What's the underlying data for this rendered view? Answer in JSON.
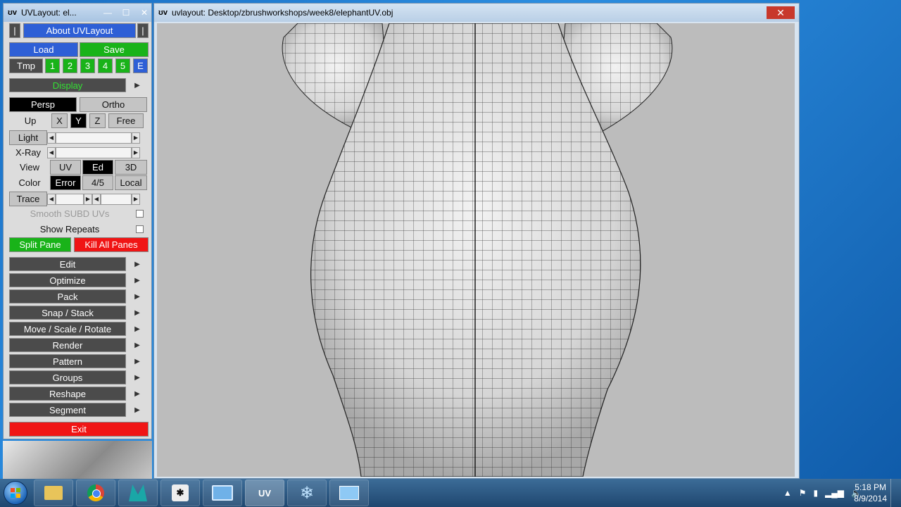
{
  "tool_window": {
    "title": "UVLayout: el...",
    "about": "About UVLayout",
    "load": "Load",
    "save": "Save",
    "tmp_label": "Tmp",
    "tmp_slots": [
      "1",
      "2",
      "3",
      "4",
      "5",
      "E"
    ],
    "display": "Display",
    "persp": "Persp",
    "ortho": "Ortho",
    "up_label": "Up",
    "up_axes": [
      "X",
      "Y",
      "Z",
      "Free"
    ],
    "light": "Light",
    "xray": "X-Ray",
    "view_label": "View",
    "view_opts": [
      "UV",
      "Ed",
      "3D"
    ],
    "color_label": "Color",
    "color_opts": [
      "Error",
      "4/5",
      "Local"
    ],
    "trace": "Trace",
    "smooth": "Smooth SUBD UVs",
    "show_repeats": "Show Repeats",
    "split_pane": "Split Pane",
    "kill_panes": "Kill All Panes",
    "menus": [
      "Edit",
      "Optimize",
      "Pack",
      "Snap / Stack",
      "Move / Scale / Rotate",
      "Render",
      "Pattern",
      "Groups",
      "Reshape",
      "Segment"
    ],
    "exit": "Exit"
  },
  "view_window": {
    "title": "uvlayout: Desktop/zbrushworkshops/week8/elephantUV.obj",
    "close": "✕"
  },
  "taskbar": {
    "uv_app": "UV",
    "time": "5:18 PM",
    "date": "8/9/2014"
  }
}
